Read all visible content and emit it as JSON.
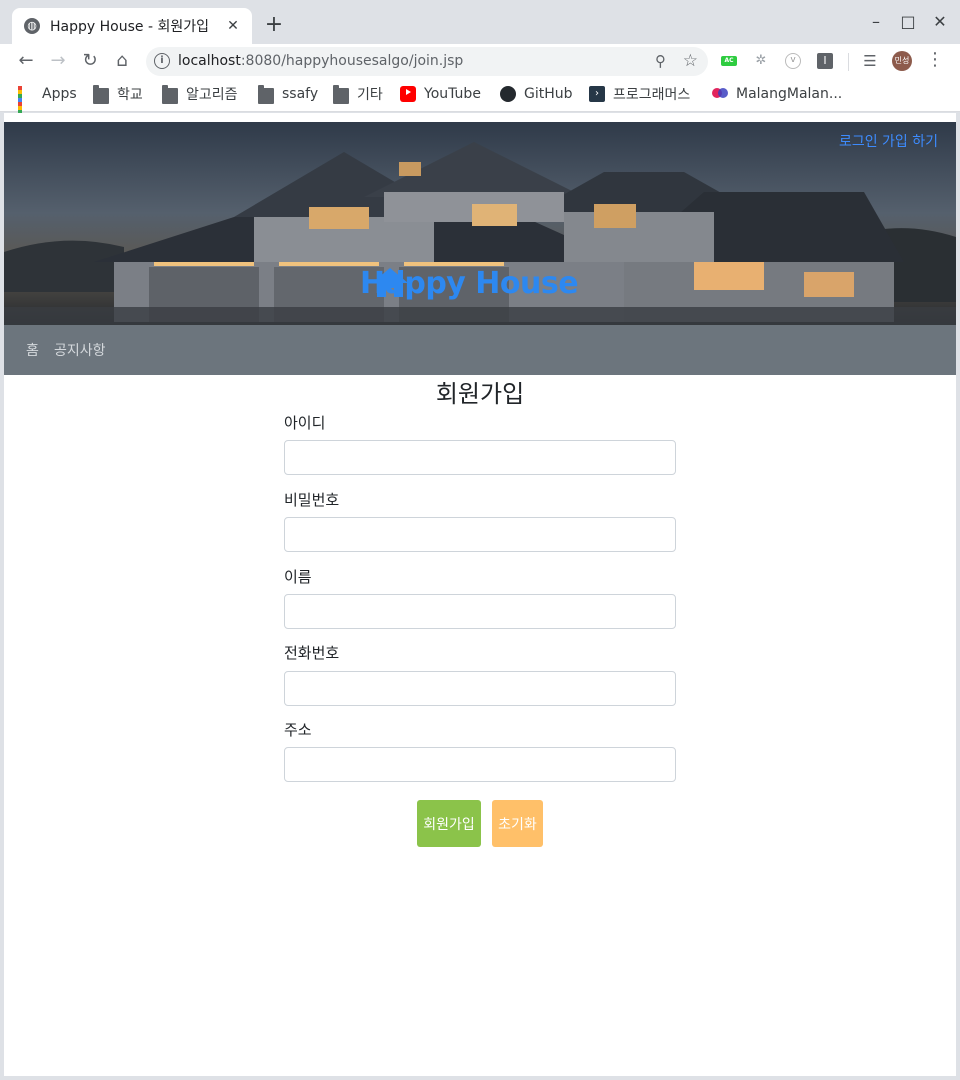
{
  "browser": {
    "tab_title": "Happy House - 회원가입",
    "tab_close": "✕",
    "new_tab": "+",
    "url_host": "localhost",
    "url_path": ":8080/happyhousesalgo/join.jsp",
    "avatar_text": "민성",
    "icons": [
      "globe-icon",
      "back-icon",
      "forward-icon",
      "reload-icon",
      "home-icon",
      "info-icon",
      "zoom-icon",
      "star-icon",
      "menu-icon"
    ]
  },
  "bookmarks": [
    {
      "label": "Apps",
      "icon": "apps-icon"
    },
    {
      "label": "학교",
      "icon": "folder-icon"
    },
    {
      "label": "알고리즘",
      "icon": "folder-icon"
    },
    {
      "label": "ssafy",
      "icon": "folder-icon"
    },
    {
      "label": "기타",
      "icon": "folder-icon"
    },
    {
      "label": "YouTube",
      "icon": "youtube-icon"
    },
    {
      "label": "GitHub",
      "icon": "github-icon"
    },
    {
      "label": "프로그래머스",
      "icon": "programmers-icon"
    },
    {
      "label": "MalangMalan...",
      "icon": "malang-icon"
    }
  ],
  "header": {
    "login_link": "로그인 가입 하기",
    "brand": "Happy House",
    "brand_color": "#2d88f0"
  },
  "nav": {
    "items": [
      "홈",
      "공지사항"
    ]
  },
  "form": {
    "title": "회원가입",
    "fields": [
      {
        "label": "아이디",
        "value": ""
      },
      {
        "label": "비밀번호",
        "value": ""
      },
      {
        "label": "이름",
        "value": ""
      },
      {
        "label": "전화번호",
        "value": ""
      },
      {
        "label": "주소",
        "value": ""
      }
    ],
    "submit_label": "회원가입",
    "reset_label": "초기화",
    "submit_color": "#8bc34a",
    "reset_color": "#ffc069"
  }
}
